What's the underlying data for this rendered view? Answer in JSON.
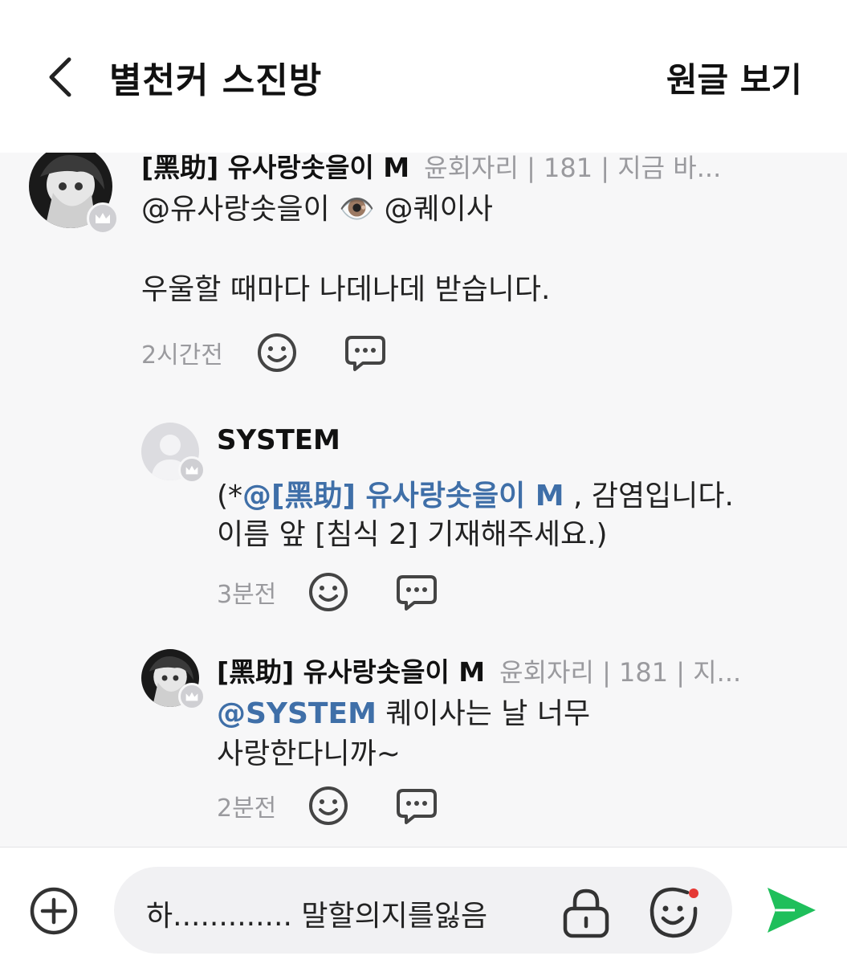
{
  "header": {
    "title": "별천커 스진방",
    "view_original": "원글 보기"
  },
  "comments": [
    {
      "author": "[黑助] 유사랑솟을이 M",
      "meta": "윤회자리 | 181 | 지금 바...",
      "mention_a": "@유사랑솟을이",
      "emoji": "👁️",
      "mention_b": "@퀘이사",
      "body": "우울할 때마다 나데나데 받습니다.",
      "time": "2시간전"
    },
    {
      "author": "SYSTEM",
      "prefix": "(*",
      "mention": "@[黑助] 유사랑솟을이 M",
      "body_1": " , 감염입니다.",
      "body_2": "이름 앞 [침식 2] 기재해주세요.)",
      "time": "3분전"
    },
    {
      "author": "[黑助] 유사랑솟을이 M",
      "meta": "윤회자리 | 181 | 지...",
      "mention": "@SYSTEM",
      "body_1": " 퀘이사는 날 너무",
      "body_2": "사랑한다니까~",
      "time": "2분전"
    }
  ],
  "composer": {
    "input_value": "하............. 말할의지를잃음"
  },
  "icons": {
    "back": "chevron-left-icon",
    "react": "smile-icon",
    "reply": "speech-bubble-icon",
    "add": "plus-circle-icon",
    "lock": "lock-icon",
    "emoji": "emoji-icon",
    "send": "send-icon"
  },
  "colors": {
    "mention": "#3f6fa8",
    "send": "#1fbf5b",
    "notification_dot": "#e53935",
    "content_bg": "#f7f7f8"
  }
}
